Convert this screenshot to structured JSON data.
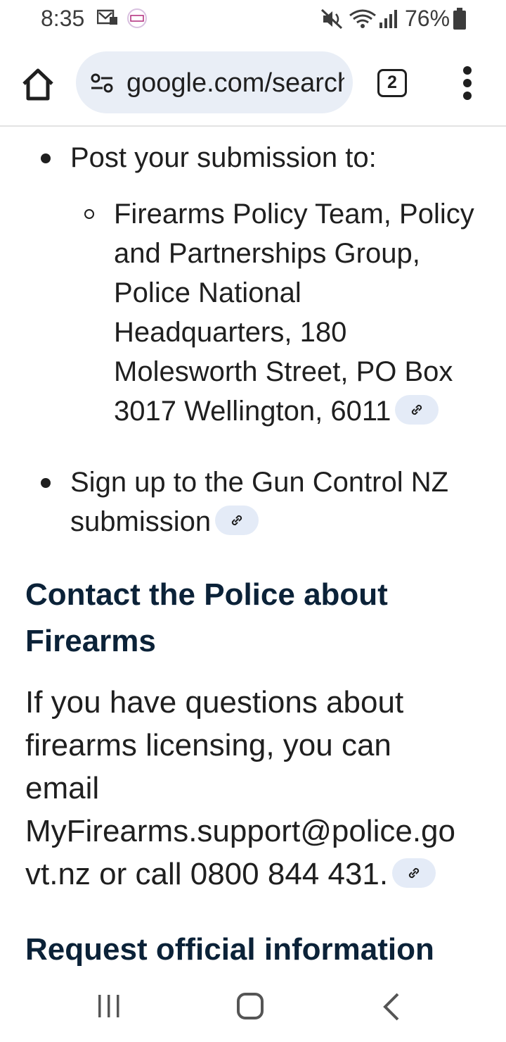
{
  "status_bar": {
    "time": "8:35",
    "battery_percent": "76%",
    "icons": [
      "notification-mail-icon",
      "notification-app-icon",
      "mute-icon",
      "wifi-icon",
      "signal-icon",
      "battery-icon"
    ]
  },
  "browser": {
    "url": "google.com/search",
    "tab_count": "2",
    "icons": [
      "home-icon",
      "site-settings-icon",
      "more-vert-icon"
    ]
  },
  "content": {
    "bullet_post": "Post your submission to:",
    "address_lines": [
      "Firearms Policy Team, Policy",
      "and Partnerships Group,",
      "Police National",
      "Headquarters, 180",
      "Molesworth Street, PO Box",
      "3017 Wellington, 6011"
    ],
    "bullet_signup_lines": [
      "Sign up to the Gun Control NZ",
      "submission"
    ],
    "heading_contact_lines": [
      "Contact the Police about",
      "Firearms"
    ],
    "contact_para_lines": [
      "If you have questions about",
      "firearms licensing, you can",
      "email",
      "MyFirearms.support@police.go",
      "vt.nz or call 0800 844 431."
    ],
    "heading_request": "Request official information"
  },
  "colors": {
    "heading": "#0b2238",
    "link_chip_bg": "#e4ebf7",
    "url_pill_bg": "#e9eef6"
  }
}
